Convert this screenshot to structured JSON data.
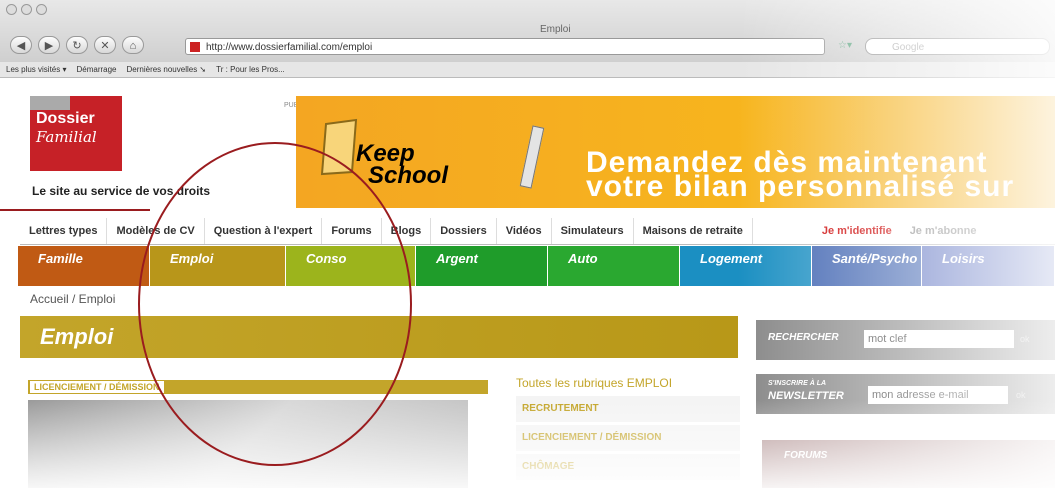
{
  "browser": {
    "window_title": "Emploi",
    "url": "http://www.dossierfamilial.com/emploi",
    "search_placeholder": "Google",
    "bookmarks": [
      "Les plus visités ▾",
      "Démarrage",
      "Dernières nouvelles ➘",
      "Tr : Pour les Pros..."
    ]
  },
  "site": {
    "logo_line1": "Dossier",
    "logo_line2": "Familial",
    "tagline": "Le site au service de vos droits",
    "pub_label": "PUBLICITE",
    "banner": {
      "brand_keep": "Keep",
      "brand_school": "School",
      "line1": "Demandez dès maintenant",
      "line2": "votre bilan personnalisé sur"
    },
    "topnav": [
      "Lettres types",
      "Modèles de CV",
      "Question à l'expert",
      "Forums",
      "Blogs",
      "Dossiers",
      "Vidéos",
      "Simulateurs",
      "Maisons de retraite"
    ],
    "login": "Je m'identifie",
    "register": "Je m'abonne",
    "categories": [
      {
        "label": "Famille",
        "color": "#c05a14"
      },
      {
        "label": "Emploi",
        "color": "#b8961a"
      },
      {
        "label": "Conso",
        "color": "#9cb41c"
      },
      {
        "label": "Argent",
        "color": "#1f9c2a"
      },
      {
        "label": "Auto",
        "color": "#2aa830"
      },
      {
        "label": "Logement",
        "color": "#1b8fc2"
      },
      {
        "label": "Santé/Psycho",
        "color": "#3d62b0"
      },
      {
        "label": "Loisirs",
        "color": "#5a6fc0"
      }
    ],
    "breadcrumb": "Accueil / Emploi",
    "page_title": "Emploi",
    "section_label": "LICENCIEMENT / DÉMISSION",
    "rubriques_heading": "Toutes les rubriques EMPLOI",
    "rubriques": [
      "RECRUTEMENT",
      "LICENCIEMENT / DÉMISSION",
      "CHÔMAGE"
    ],
    "search": {
      "label": "RECHERCHER",
      "value": "mot clef",
      "ok": "ok"
    },
    "newsletter": {
      "label_small": "S'INSCRIRE À LA",
      "label": "NEWSLETTER",
      "value": "mon adresse e-mail",
      "ok": "ok"
    },
    "forums_label": "FORUMS"
  }
}
